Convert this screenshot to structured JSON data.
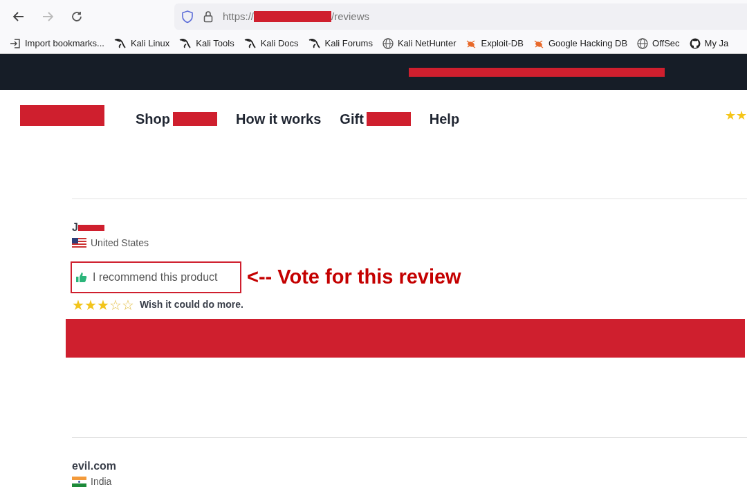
{
  "browser": {
    "url_prefix": "https://",
    "url_suffix": "/reviews",
    "bookmarks": [
      {
        "label": "Import bookmarks...",
        "kind": "import"
      },
      {
        "label": "Kali Linux",
        "kind": "kali"
      },
      {
        "label": "Kali Tools",
        "kind": "kali"
      },
      {
        "label": "Kali Docs",
        "kind": "kali"
      },
      {
        "label": "Kali Forums",
        "kind": "kali"
      },
      {
        "label": "Kali NetHunter",
        "kind": "globe"
      },
      {
        "label": "Exploit-DB",
        "kind": "bug"
      },
      {
        "label": "Google Hacking DB",
        "kind": "bug"
      },
      {
        "label": "OffSec",
        "kind": "globe"
      },
      {
        "label": "My Ja",
        "kind": "github"
      }
    ]
  },
  "header_rating": "★★",
  "nav": {
    "links": [
      {
        "label": "Shop",
        "redacted": true
      },
      {
        "label": "How it works",
        "redacted": false
      },
      {
        "label": "Gift",
        "redacted": true
      },
      {
        "label": "Help",
        "redacted": false
      }
    ]
  },
  "reviews": [
    {
      "name": "J",
      "country": "United States",
      "kind": "us",
      "recommend": "I recommend this product",
      "stars": 3,
      "title": "Wish it could do more.",
      "annotation": "<-- Vote for this review"
    },
    {
      "name": "evil.com",
      "country": "India",
      "kind": "in"
    }
  ]
}
